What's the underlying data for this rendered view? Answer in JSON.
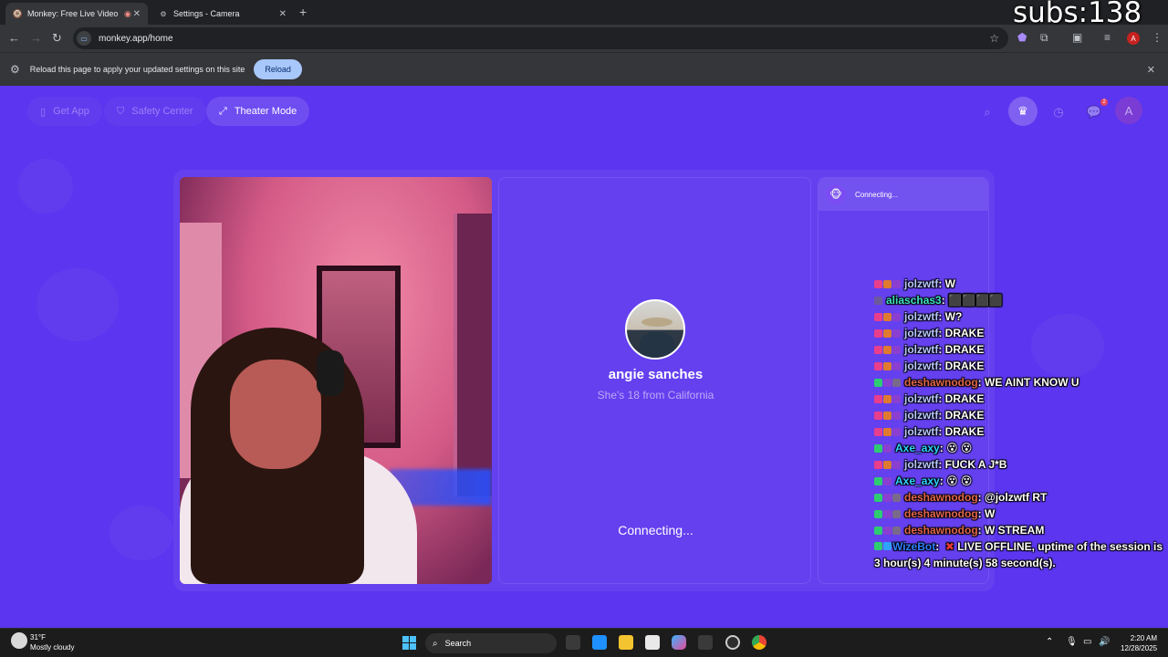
{
  "browser": {
    "tabs": [
      {
        "title": "Monkey: Free Live Video Ch",
        "active": true
      },
      {
        "title": "Settings - Camera",
        "active": false
      }
    ],
    "address": "monkey.app/home",
    "infobar_message": "Reload this page to apply your updated settings on this site",
    "infobar_button": "Reload",
    "profile_initial": "A"
  },
  "stream_overlay": {
    "subs_counter": "subs:138"
  },
  "app": {
    "nav": {
      "get_app": "Get App",
      "safety_center": "Safety Center",
      "theater_mode": "Theater Mode"
    },
    "notification_count": "2",
    "user_initial": "A",
    "peer": {
      "name": "angie sanches",
      "subtitle": "She's 18 from California",
      "status": "Connecting..."
    },
    "chat_panel": {
      "status": "Connecting..."
    }
  },
  "chat_overlay": {
    "messages": [
      {
        "user": "jolzwtf",
        "user_color": "#b7c8ff",
        "text": "W",
        "badges": [
          "#e83e8c",
          "#e07a2e",
          "#8b3fd1"
        ]
      },
      {
        "user": "aliaschas3",
        "user_color": "#3fe3c4",
        "text": "⬛⬛⬛⬛",
        "badges": [
          "#6b5a9e"
        ]
      },
      {
        "user": "jolzwtf",
        "user_color": "#b7c8ff",
        "text": "W?",
        "badges": [
          "#e83e8c",
          "#e07a2e",
          "#8b3fd1"
        ]
      },
      {
        "user": "jolzwtf",
        "user_color": "#b7c8ff",
        "text": "DRAKE",
        "badges": [
          "#e83e8c",
          "#e07a2e",
          "#8b3fd1"
        ]
      },
      {
        "user": "jolzwtf",
        "user_color": "#b7c8ff",
        "text": "DRAKE",
        "badges": [
          "#e83e8c",
          "#e07a2e",
          "#8b3fd1"
        ]
      },
      {
        "user": "jolzwtf",
        "user_color": "#b7c8ff",
        "text": "DRAKE",
        "badges": [
          "#e83e8c",
          "#e07a2e",
          "#8b3fd1"
        ]
      },
      {
        "user": "deshawnodog",
        "user_color": "#e0654a",
        "text": "WE AINT KNOW U",
        "badges": [
          "#2ecc71",
          "#8b3fd1",
          "#7a6a8a"
        ]
      },
      {
        "user": "jolzwtf",
        "user_color": "#b7c8ff",
        "text": "DRAKE",
        "badges": [
          "#e83e8c",
          "#e07a2e",
          "#8b3fd1"
        ]
      },
      {
        "user": "jolzwtf",
        "user_color": "#b7c8ff",
        "text": "DRAKE",
        "badges": [
          "#e83e8c",
          "#e07a2e",
          "#8b3fd1"
        ]
      },
      {
        "user": "jolzwtf",
        "user_color": "#b7c8ff",
        "text": "DRAKE",
        "badges": [
          "#e83e8c",
          "#e07a2e",
          "#8b3fd1"
        ]
      },
      {
        "user": "Axe_axy",
        "user_color": "#2fd3ff",
        "text": "😵 😵",
        "badges": [
          "#2ecc71",
          "#8b3fd1"
        ]
      },
      {
        "user": "jolzwtf",
        "user_color": "#b7c8ff",
        "text": "FUCK A J*B",
        "badges": [
          "#e83e8c",
          "#e07a2e",
          "#8b3fd1"
        ]
      },
      {
        "user": "Axe_axy",
        "user_color": "#2fd3ff",
        "text": "😵 😵",
        "badges": [
          "#2ecc71",
          "#8b3fd1"
        ]
      },
      {
        "user": "deshawnodog",
        "user_color": "#e0654a",
        "text": "@jolzwtf RT",
        "badges": [
          "#2ecc71",
          "#8b3fd1",
          "#7a6a8a"
        ]
      },
      {
        "user": "deshawnodog",
        "user_color": "#e0654a",
        "text": "W",
        "badges": [
          "#2ecc71",
          "#8b3fd1",
          "#7a6a8a"
        ]
      },
      {
        "user": "deshawnodog",
        "user_color": "#e0654a",
        "text": "W STREAM",
        "badges": [
          "#2ecc71",
          "#8b3fd1",
          "#7a6a8a"
        ]
      }
    ],
    "bot": {
      "user": "WizeBot",
      "user_color": "#2f7fff",
      "text": "LIVE OFFLINE, uptime of the session is 3 hour(s) 4 minute(s) 58 second(s)."
    }
  },
  "taskbar": {
    "temperature": "31°F",
    "weather": "Mostly cloudy",
    "search_placeholder": "Search",
    "time": "2:20 AM",
    "date": "12/28/2025"
  }
}
